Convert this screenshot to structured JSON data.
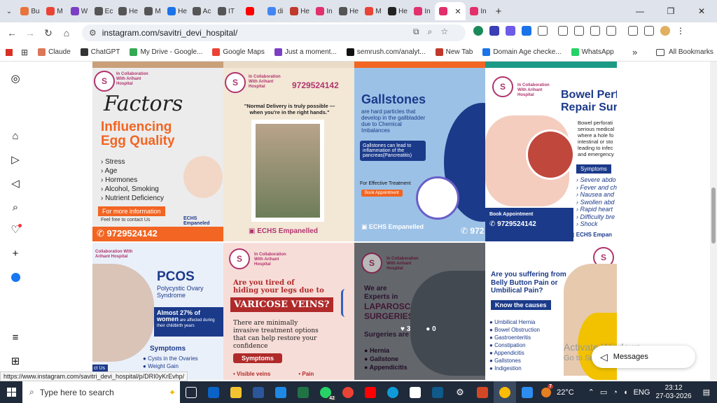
{
  "browser": {
    "tabs": [
      {
        "label": "Bu",
        "color": "#e8743b"
      },
      {
        "label": "M",
        "color": "#ea4335"
      },
      {
        "label": "W",
        "color": "#7b3fc4"
      },
      {
        "label": "Ec",
        "color": "#555555"
      },
      {
        "label": "He",
        "color": "#555555"
      },
      {
        "label": "M",
        "color": "#555555"
      },
      {
        "label": "He",
        "color": "#1a73e8"
      },
      {
        "label": "Ac",
        "color": "#555555"
      },
      {
        "label": "IT",
        "color": "#555555"
      },
      {
        "label": "",
        "color": "#ff0000"
      },
      {
        "label": "di",
        "color": "#4285f4"
      },
      {
        "label": "He",
        "color": "#c0392b"
      },
      {
        "label": "In",
        "color": "#e1306c"
      },
      {
        "label": "He",
        "color": "#555555"
      },
      {
        "label": "M",
        "color": "#ea4335"
      },
      {
        "label": "He",
        "color": "#222222"
      },
      {
        "label": "In",
        "color": "#e1306c"
      },
      {
        "label": "",
        "color": "#e1306c",
        "active": true
      },
      {
        "label": "In",
        "color": "#e1306c"
      }
    ],
    "new_tab": "+",
    "url": "instagram.com/savitri_devi_hospital/",
    "window_controls": {
      "minimize": "—",
      "restore": "❐",
      "close": "✕"
    }
  },
  "bookmarks": [
    {
      "label": "Claude",
      "color": "#d97757"
    },
    {
      "label": "ChatGPT",
      "color": "#333333"
    },
    {
      "label": "My Drive - Google...",
      "color": "#34a853"
    },
    {
      "label": "Google Maps",
      "color": "#ea4335"
    },
    {
      "label": "Just a moment...",
      "color": "#7b3fc4"
    },
    {
      "label": "semrush.com/analyt...",
      "color": "#111111"
    },
    {
      "label": "New Tab",
      "color": "#c0392b"
    },
    {
      "label": "Domain Age checke...",
      "color": "#1a73e8"
    },
    {
      "label": "WhatsApp",
      "color": "#25d366"
    }
  ],
  "bookmarks_more": "»",
  "all_bookmarks": "All Bookmarks",
  "sidebar_icons": [
    "instagram-icon",
    "home-icon",
    "reels-icon",
    "send-icon",
    "search-icon",
    "heart-icon",
    "plus-icon",
    "profile-icon",
    "menu-icon",
    "apps-icon"
  ],
  "posts": {
    "p1": {
      "title1": "Factors",
      "title2": "Influencing",
      "title3": "Egg Quality",
      "list": [
        "Stress",
        "Age",
        "Hormones",
        "Alcohol, Smoking",
        "Nutrient Deficiency"
      ],
      "more": "For more information",
      "contact": "Feel free to contact Us",
      "phone": "9729524142",
      "echs": "ECHS Empaneled"
    },
    "p2": {
      "collab": "In Collaboration With Arihant Hospital",
      "phone": "9729524142",
      "quote": "\"Normal Delivery is truly possible — when you're in the right hands.\"",
      "echs": "ECHS Empanelled"
    },
    "p3": {
      "title": "Gallstones",
      "sub": "are hard particles that develop in the gallbladder due to Chemical Imbalances",
      "box": "Gallstones can lead to inflammation of the pancreas(Pancreatitis)",
      "effective": "For Effective Treatment",
      "book": "Book Appointment",
      "echs": "ECHS Empanelled",
      "phone": "972"
    },
    "p4": {
      "collab": "In Collaboration With Arihant Hospital",
      "title1": "Bowel Perfo",
      "title2": "Repair Surg",
      "desc": "Bowel perforati serious medical where a hole fo intestinal or sto leading to infec and emergency",
      "symptoms": "Symptoms",
      "list": [
        "Severe abdo",
        "Fever and ch",
        "Nausea and",
        "Swollen abd",
        "Rapid heart",
        "Difficulty bre",
        "Shock"
      ],
      "book": "Book Appointment",
      "phone": "9729524142",
      "echs": "ECHS Empan"
    },
    "p5": {
      "collab": "Collaboration With Arihant Hospital",
      "title": "PCOS",
      "sub": "Polycystic Ovary Syndrome",
      "stat1": "Almost 27% of",
      "stat2": "women",
      "stat3": "are affected during their childbirth years",
      "symptoms": "Symptoms",
      "list": [
        "Cysts in the Ovaries",
        "Weight Gain"
      ],
      "cta": "ct Us"
    },
    "p6": {
      "collab": "In Collaboration With Arihant Hospital",
      "q1": "Are you tired of",
      "q2": "hiding your legs due to",
      "title": "VARICOSE VEINS?",
      "desc": "There are minimally invasive treatment options that can help restore your confidence",
      "symptoms": "Symptoms",
      "list": [
        "Visible veins",
        "Pain"
      ]
    },
    "p7": {
      "collab": "In Collaboration With Arihant Hospital",
      "t1": "We are",
      "t2": "Experts in",
      "t3": "LAPAROSCOPIC",
      "t4": "SURGERIES",
      "t5": "Surgeries are",
      "list": [
        "Hernia",
        "Gallstone",
        "Appendicitis"
      ],
      "likes": "3",
      "comments": "0"
    },
    "p8": {
      "q": "Are you suffering from",
      "title": "Belly Button Pain or Umbilical Pain?",
      "know": "Know the causes",
      "list": [
        "Umbilical Hernia",
        "Bowel Obstruction",
        "Gastroenteritis",
        "Constipation",
        "Appendicitis",
        "Gallstones",
        "Indigestion"
      ]
    }
  },
  "status_url": "https://www.instagram.com/savitri_devi_hospital/p/DRI0yKrEvhp/",
  "watermark": {
    "line1": "Activate Windows",
    "line2": "Go to Settings to activate Windows."
  },
  "messages": "Messages",
  "taskbar": {
    "search": "Type here to search",
    "badge": "42",
    "temp": "22°C",
    "weather_badge": "7",
    "lang": "ENG",
    "time": "23:12",
    "date": "27-03-2026"
  }
}
